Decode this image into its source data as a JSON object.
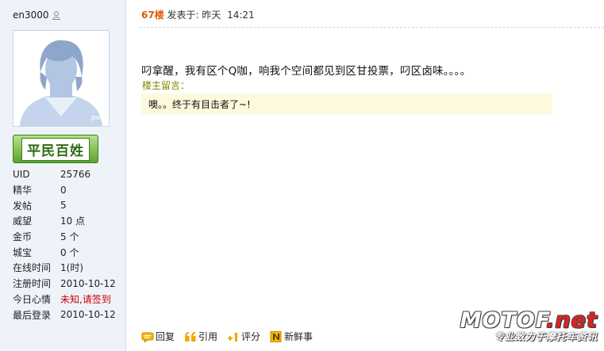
{
  "user": {
    "name": "en3000",
    "rank": "平民百姓",
    "avatar_caption": "pw",
    "stats": [
      {
        "label": "UID",
        "value": "25766",
        "highlight": false
      },
      {
        "label": "精华",
        "value": "0",
        "highlight": false
      },
      {
        "label": "发帖",
        "value": "5",
        "highlight": false
      },
      {
        "label": "威望",
        "value": "10 点",
        "highlight": false
      },
      {
        "label": "金币",
        "value": "5 个",
        "highlight": false
      },
      {
        "label": "城宝",
        "value": "0 个",
        "highlight": false
      },
      {
        "label": "在线时间",
        "value": "1(时)",
        "highlight": false
      },
      {
        "label": "注册时间",
        "value": "2010-10-12",
        "highlight": false
      },
      {
        "label": "今日心情",
        "value": "未知,请签到",
        "highlight": true
      },
      {
        "label": "最后登录",
        "value": "2010-10-12",
        "highlight": false
      }
    ]
  },
  "post": {
    "floor": "67楼",
    "posted_at_label": "发表于:",
    "posted_day": "昨天",
    "posted_time": "14:21",
    "content": "叼拿醒，我有区个Q咖，响我个空间都见到区甘投票，叼区卤味。。。。",
    "owner_note_label": "楼主留言：",
    "owner_note": "噢。。终于有目击者了~!"
  },
  "actions": [
    {
      "label": "回复",
      "icon": "reply-icon",
      "name": "reply-button"
    },
    {
      "label": "引用",
      "icon": "quote-icon",
      "name": "quote-button"
    },
    {
      "label": "评分",
      "icon": "rate-icon",
      "name": "rate-button"
    },
    {
      "label": "新鲜事",
      "icon": "news-icon",
      "name": "news-button"
    }
  ],
  "watermark": {
    "title_main": "MOTOF",
    "title_accent": ".net",
    "subtitle": "专业致力于摩托车资讯"
  },
  "colors": {
    "sidebar_bg": "#eef3fa",
    "floor": "#e05a00",
    "mood_red": "#cc0000",
    "note_bg": "#fdf9dc",
    "badge_green": "#5aa52a"
  }
}
